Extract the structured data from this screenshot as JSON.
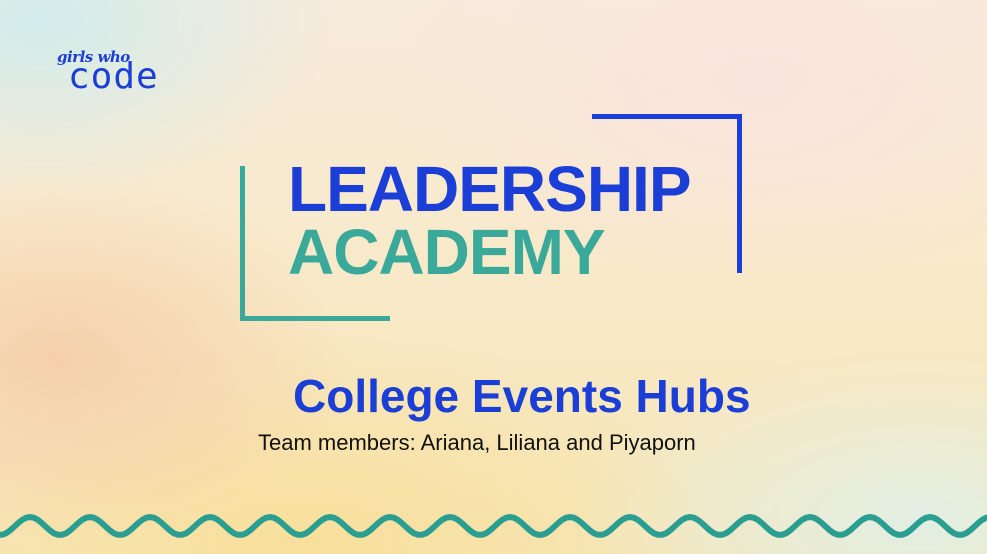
{
  "logo": {
    "line1": "girls who",
    "line2": "code"
  },
  "slide": {
    "title_line1": "LEADERSHIP",
    "title_line2": "ACADEMY",
    "subtitle": "College Events Hubs",
    "team": "Team members: Ariana, Liliana and Piyaporn"
  },
  "colors": {
    "blue": "#1b3fd6",
    "teal": "#3aa99a"
  },
  "icons": [
    "girls-who-code-logo",
    "wave-decoration"
  ]
}
